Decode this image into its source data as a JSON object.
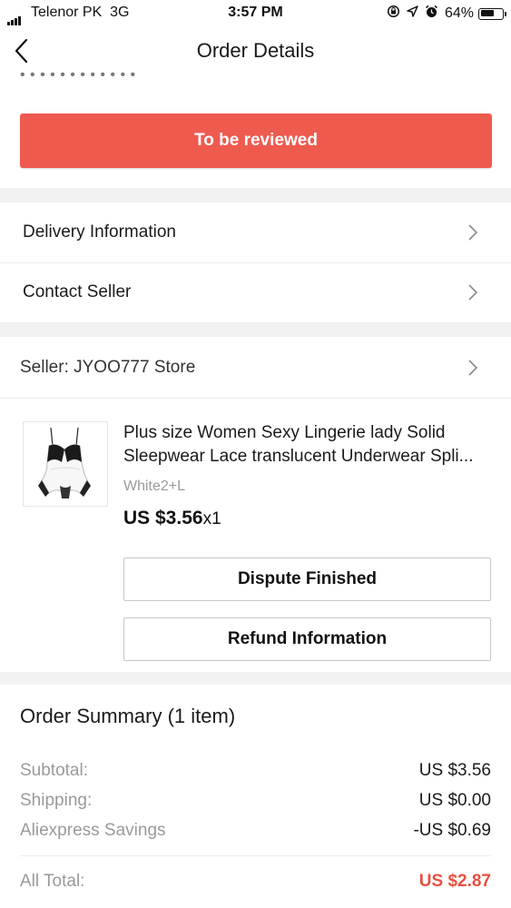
{
  "status_bar": {
    "carrier": "Telenor PK",
    "network": "3G",
    "time": "3:57 PM",
    "battery": "64%",
    "battery_level": 0.64,
    "icons": [
      "signal-bars-icon",
      "screen-rotation-lock-icon",
      "location-arrow-icon",
      "alarm-icon",
      "battery-icon"
    ]
  },
  "header": {
    "title": "Order Details",
    "back_icon": "chevron-left-icon"
  },
  "primary_action": {
    "label": "To be reviewed",
    "color": "#ef5a4f"
  },
  "menu": {
    "delivery_label": "Delivery Information",
    "contact_label": "Contact Seller",
    "chevron_icon": "chevron-right-icon"
  },
  "seller": {
    "label": "Seller: JYOO777 Store"
  },
  "product": {
    "image_icon": "lingerie-product-thumbnail",
    "title_line1": "Plus size Women Sexy Lingerie lady Solid",
    "title_line2": "Sleepwear Lace translucent  Underwear Spli...",
    "variant": "White2+L",
    "price": "US $3.56",
    "quantity": "x1"
  },
  "actions": {
    "dispute_label": "Dispute Finished",
    "refund_label": "Refund Information"
  },
  "summary": {
    "title": "Order Summary (1 item)",
    "rows": [
      {
        "label": "Subtotal:",
        "value": "US $3.56"
      },
      {
        "label": "Shipping:",
        "value": "US $0.00"
      },
      {
        "label": "Aliexpress Savings",
        "value": "-US $0.69"
      }
    ],
    "total_label": "All Total:",
    "total_value": "US $2.87",
    "total_color": "#e8503f"
  }
}
